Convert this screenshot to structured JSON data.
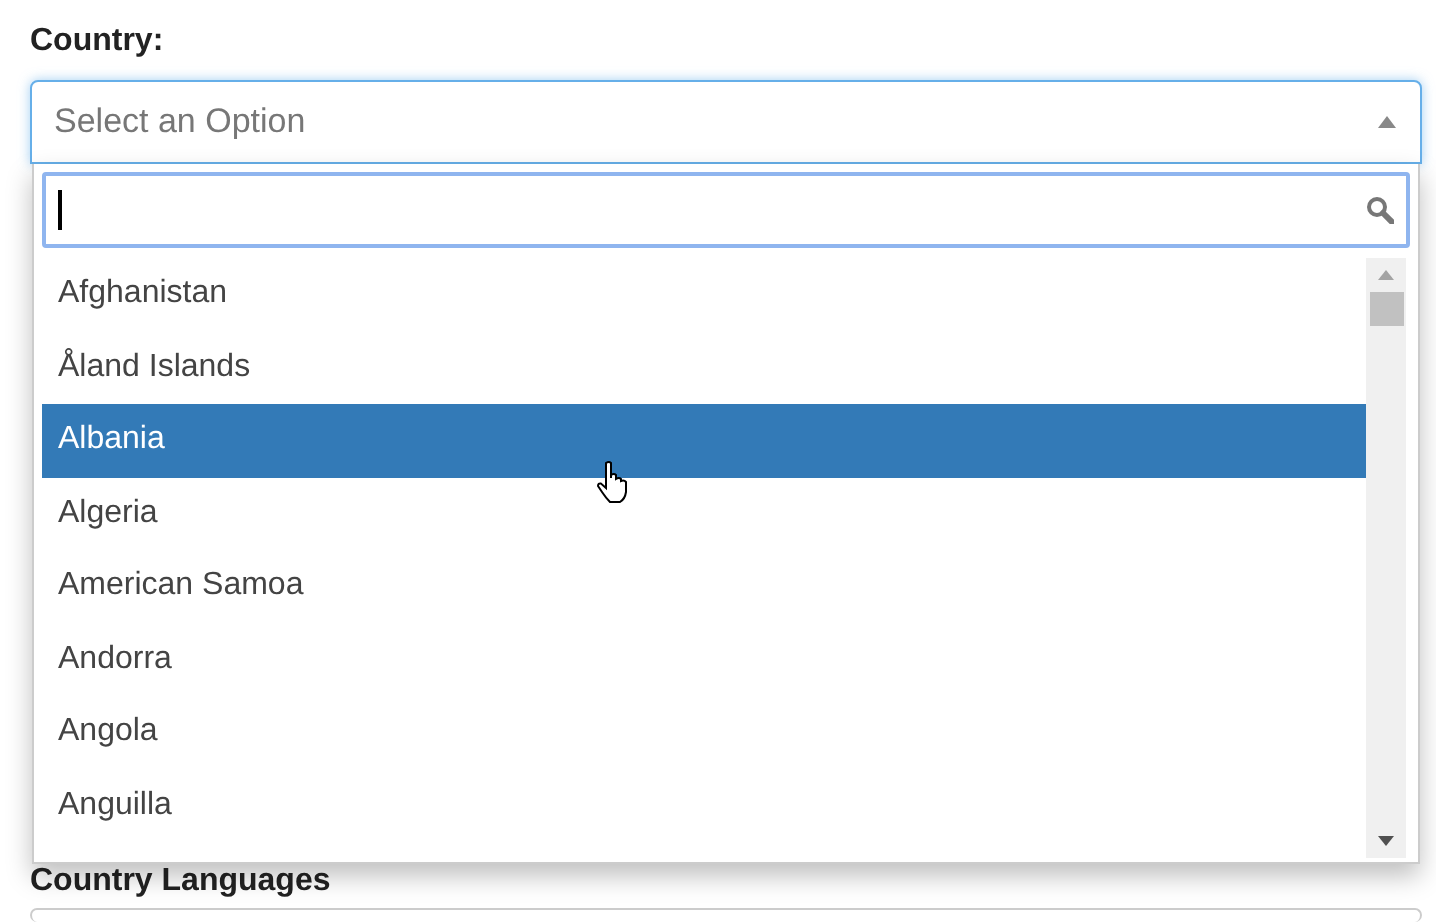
{
  "fields": [
    {
      "label": "Country:",
      "placeholder": "Select an Option",
      "expanded": true
    },
    {
      "label": "Country Languages"
    }
  ],
  "dropdown": {
    "search": {
      "caret": true
    },
    "options": [
      {
        "label": "Afghanistan",
        "selected": false
      },
      {
        "label": "Åland Islands",
        "selected": false
      },
      {
        "label": "Albania",
        "selected": true
      },
      {
        "label": "Algeria",
        "selected": false
      },
      {
        "label": "American Samoa",
        "selected": false
      },
      {
        "label": "Andorra",
        "selected": false
      },
      {
        "label": "Angola",
        "selected": false
      },
      {
        "label": "Anguilla",
        "selected": false
      }
    ]
  }
}
